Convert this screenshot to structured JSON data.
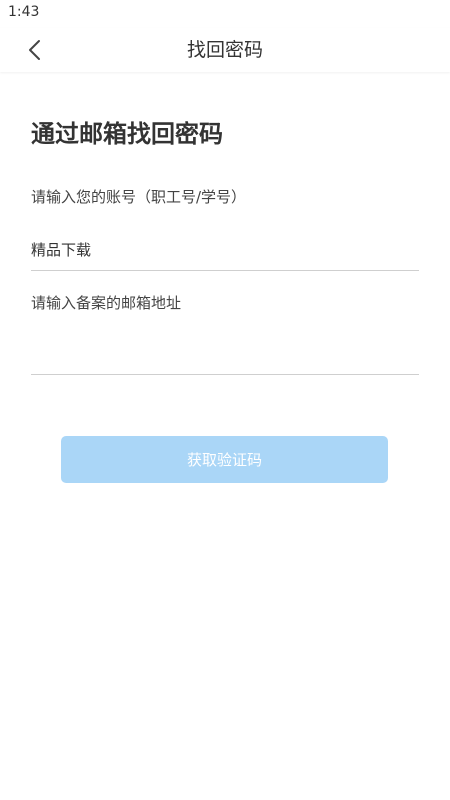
{
  "status_bar": {
    "time": "1:43"
  },
  "nav": {
    "title": "找回密码",
    "back_icon": "chevron-left-icon"
  },
  "form": {
    "heading": "通过邮箱找回密码",
    "account_label": "请输入您的账号（职工号/学号）",
    "account_value": "精品下载",
    "email_label": "请输入备案的邮箱地址",
    "email_value": ""
  },
  "actions": {
    "get_code_label": "获取验证码"
  },
  "colors": {
    "button_bg": "#aad6f7",
    "button_text": "#ffffff",
    "divider": "#cfcfcf"
  }
}
